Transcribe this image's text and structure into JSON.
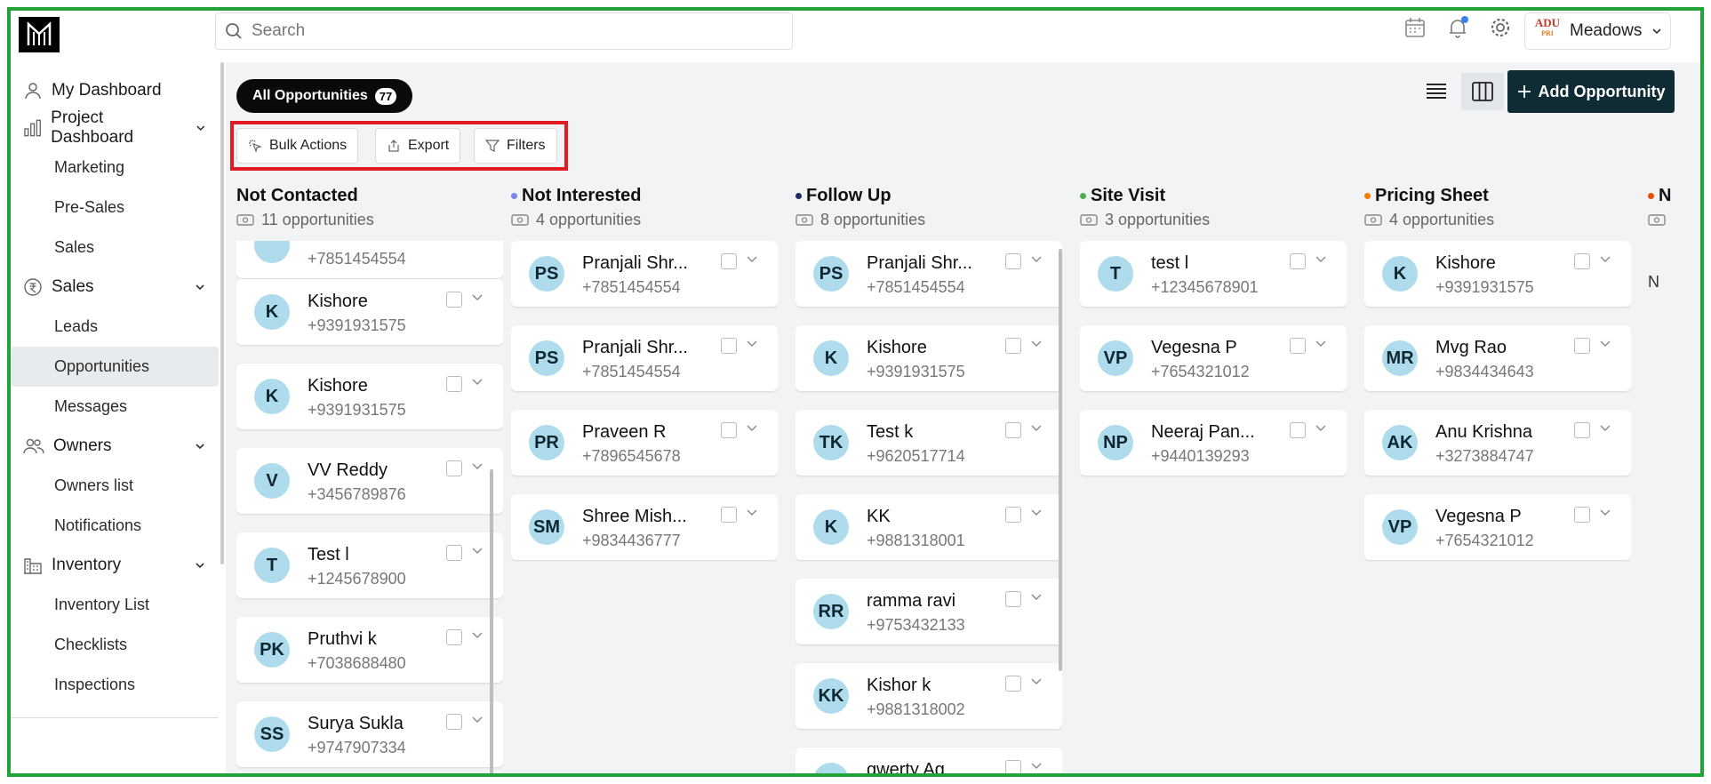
{
  "app": {
    "logo": "M"
  },
  "search": {
    "placeholder": "Search"
  },
  "user": {
    "brand_line1": "ADU",
    "brand_line2": "PRI",
    "name": "Meadows"
  },
  "sidebar": {
    "my_dashboard": "My Dashboard",
    "project_dashboard": "Project Dashboard",
    "project_items": [
      "Marketing",
      "Pre-Sales",
      "Sales"
    ],
    "sales": "Sales",
    "sales_items": [
      "Leads",
      "Opportunities",
      "Messages"
    ],
    "owners": "Owners",
    "owners_items": [
      "Owners list",
      "Notifications"
    ],
    "inventory": "Inventory",
    "inventory_items": [
      "Inventory List",
      "Checklists",
      "Inspections"
    ]
  },
  "tabs": {
    "all_label": "All Opportunities",
    "all_count": "77"
  },
  "toolbar": {
    "bulk": "Bulk Actions",
    "export": "Export",
    "filters": "Filters",
    "add": "Add Opportunity"
  },
  "colors": {
    "accent": "#0f2b34",
    "highlight": "#e01b24",
    "frame": "#22a33a",
    "avatar": "#aedcec"
  },
  "columns": [
    {
      "title": "Not Contacted",
      "count": "11 opportunities",
      "dot": "",
      "cards": [
        {
          "initials": "",
          "name": "",
          "phone": "+7851454554"
        },
        {
          "initials": "K",
          "name": "Kishore",
          "phone": "+9391931575"
        },
        {
          "initials": "K",
          "name": "Kishore",
          "phone": "+9391931575"
        },
        {
          "initials": "V",
          "name": "VV Reddy",
          "phone": "+3456789876"
        },
        {
          "initials": "T",
          "name": "Test l",
          "phone": "+1245678900"
        },
        {
          "initials": "PK",
          "name": "Pruthvi k",
          "phone": "+7038688480"
        },
        {
          "initials": "SS",
          "name": "Surya Sukla",
          "phone": "+9747907334"
        }
      ]
    },
    {
      "title": "Not Interested",
      "count": "4 opportunities",
      "dot": "#7b86e8",
      "cards": [
        {
          "initials": "PS",
          "name": "Pranjali Shr...",
          "phone": "+7851454554"
        },
        {
          "initials": "PS",
          "name": "Pranjali Shr...",
          "phone": "+7851454554"
        },
        {
          "initials": "PR",
          "name": "Praveen R",
          "phone": "+7896545678"
        },
        {
          "initials": "SM",
          "name": "Shree Mish...",
          "phone": "+9834436777"
        }
      ]
    },
    {
      "title": "Follow Up",
      "count": "8 opportunities",
      "dot": "#1f2a6b",
      "cards": [
        {
          "initials": "PS",
          "name": "Pranjali Shr...",
          "phone": "+7851454554"
        },
        {
          "initials": "K",
          "name": "Kishore",
          "phone": "+9391931575"
        },
        {
          "initials": "TK",
          "name": "Test k",
          "phone": "+9620517714"
        },
        {
          "initials": "K",
          "name": "KK",
          "phone": "+9881318001"
        },
        {
          "initials": "RR",
          "name": "ramma ravi",
          "phone": "+9753432133"
        },
        {
          "initials": "KK",
          "name": "Kishor k",
          "phone": "+9881318002"
        },
        {
          "initials": "",
          "name": "qwerty Ag",
          "phone": ""
        }
      ]
    },
    {
      "title": "Site Visit",
      "count": "3 opportunities",
      "dot": "#4caf50",
      "cards": [
        {
          "initials": "T",
          "name": "test l",
          "phone": "+12345678901"
        },
        {
          "initials": "VP",
          "name": "Vegesna P",
          "phone": "+7654321012"
        },
        {
          "initials": "NP",
          "name": "Neeraj Pan...",
          "phone": "+9440139293"
        }
      ]
    },
    {
      "title": "Pricing Sheet",
      "count": "4 opportunities",
      "dot": "#f57c00",
      "cards": [
        {
          "initials": "K",
          "name": "Kishore",
          "phone": "+9391931575"
        },
        {
          "initials": "MR",
          "name": "Mvg Rao",
          "phone": "+9834434643"
        },
        {
          "initials": "AK",
          "name": "Anu Krishna",
          "phone": "+3273884747"
        },
        {
          "initials": "VP",
          "name": "Vegesna P",
          "phone": "+7654321012"
        }
      ]
    },
    {
      "title": "N",
      "count": "",
      "dot": "#e65100",
      "cards": [],
      "empty_text": "N"
    }
  ]
}
